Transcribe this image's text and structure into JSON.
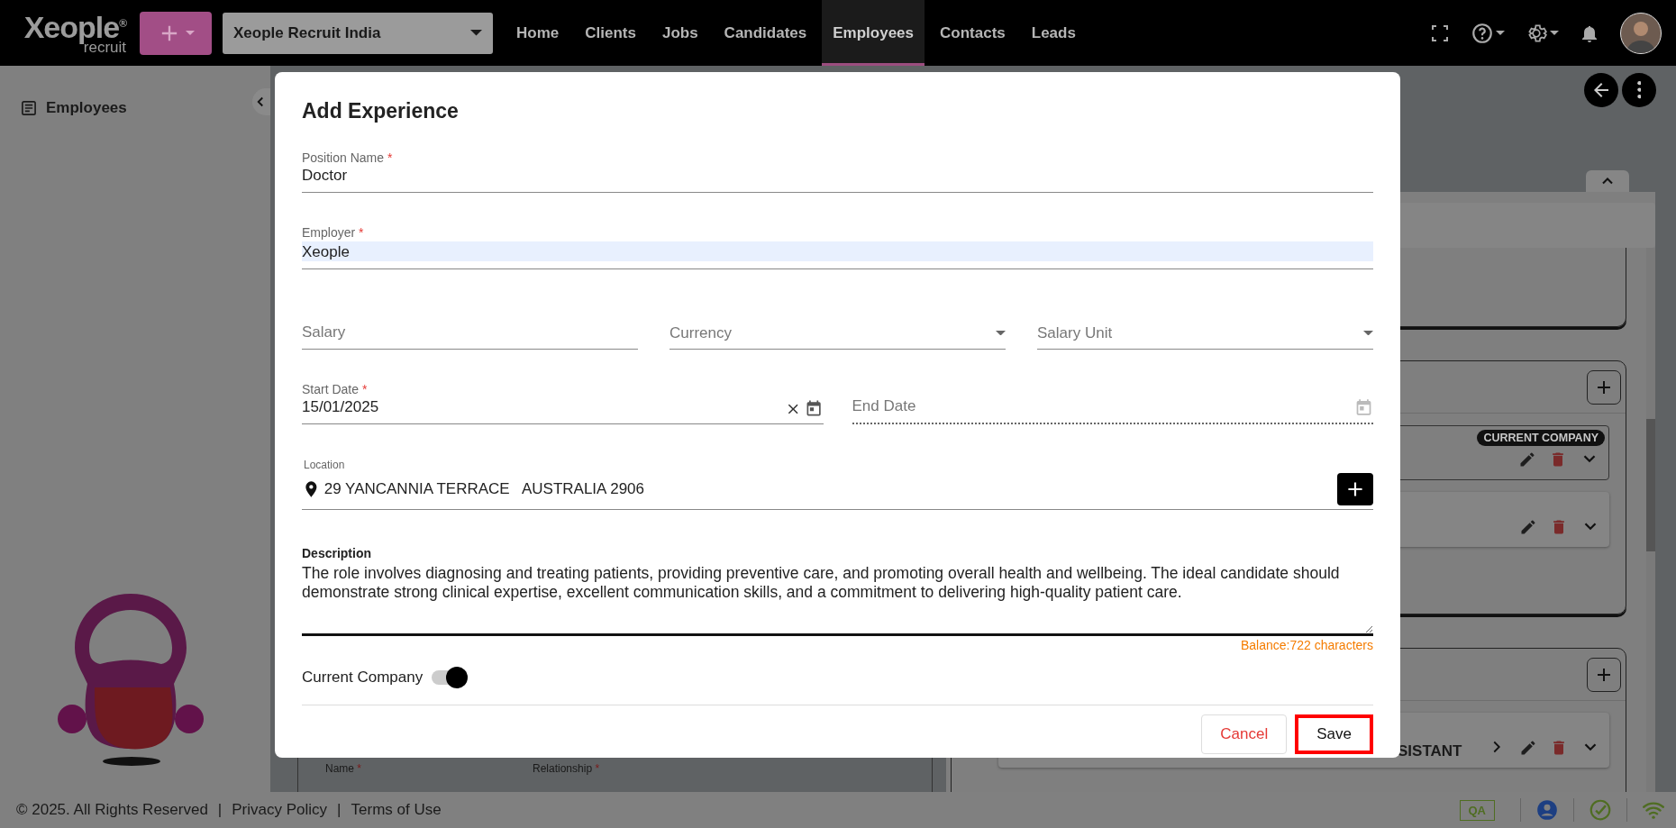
{
  "header": {
    "logo": "Xeople$^{®}$",
    "logo_sub": "recruit",
    "company": "Xeople Recruit India",
    "nav": [
      {
        "label": "Home",
        "selected": false
      },
      {
        "label": "Clients",
        "selected": false
      },
      {
        "label": "Jobs",
        "selected": false
      },
      {
        "label": "Candidates",
        "selected": false
      },
      {
        "label": "Employees",
        "selected": true
      },
      {
        "label": "Contacts",
        "selected": false
      },
      {
        "label": "Leads",
        "selected": false
      }
    ]
  },
  "sidebar": {
    "title": "Employees"
  },
  "background": {
    "current_badge": "CURRENT COMPANY",
    "partial_title": "SISTANT",
    "contact_fields": [
      {
        "label": "Name",
        "required_mark": "*"
      },
      {
        "label": "Relationship",
        "required_mark": "*"
      }
    ]
  },
  "dialog": {
    "title": "Add Experience",
    "position": {
      "label": "Position Name",
      "required_mark": "*",
      "value": "Doctor"
    },
    "employer": {
      "label": "Employer",
      "required_mark": "*",
      "value": "Xeople",
      "autofilled": true
    },
    "salary": {
      "placeholder": "Salary"
    },
    "currency": {
      "placeholder": "Currency"
    },
    "salary_unit": {
      "placeholder": "Salary Unit"
    },
    "start_date": {
      "label": "Start Date",
      "required_mark": "*",
      "value": "15/01/2025"
    },
    "end_date": {
      "placeholder": "End Date",
      "disabled": true
    },
    "location": {
      "label": "Location",
      "value": "29 YANCANNIA TERRACE   AUSTRALIA 2906"
    },
    "description": {
      "label": "Description",
      "value": "The role involves diagnosing and treating patients, providing preventive care, and promoting overall health and wellbeing. The ideal candidate should demonstrate strong clinical expertise, excellent communication skills, and a commitment to delivering high-quality patient care.",
      "balance": "Balance:722 characters"
    },
    "current_company": {
      "label": "Current Company",
      "on": true
    },
    "buttons": [
      {
        "label": "Cancel",
        "kind": "cancel",
        "focused": false
      },
      {
        "label": "Save",
        "kind": "save",
        "focused": true
      }
    ]
  },
  "footer": {
    "copyright": "© 2025. All Rights Reserved",
    "items": [
      {
        "kind": "sep",
        "text": "|"
      },
      {
        "kind": "link",
        "text": "Privacy Policy"
      },
      {
        "kind": "sep",
        "text": "|"
      },
      {
        "kind": "link",
        "text": "Terms of Use"
      }
    ],
    "env_badge": "QA"
  }
}
